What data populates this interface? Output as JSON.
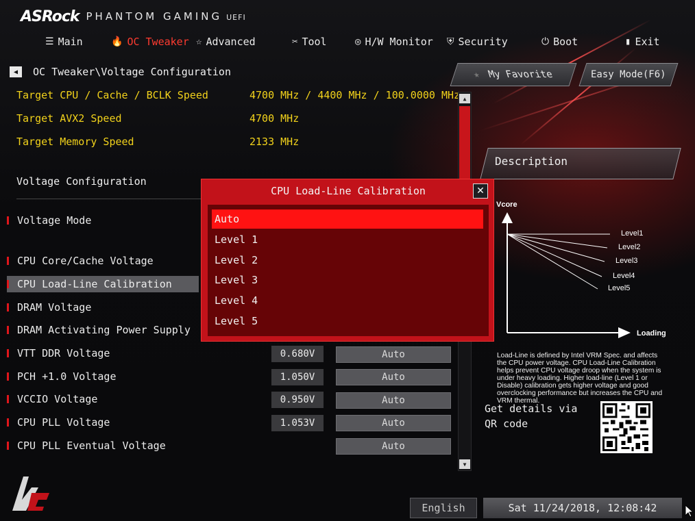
{
  "brand": {
    "name": "ASRock",
    "product": "PHANTOM GAMING",
    "uefi": "UEFI"
  },
  "nav": {
    "tabs": [
      {
        "label": "Main",
        "icon": "list-icon"
      },
      {
        "label": "OC Tweaker",
        "icon": "flame-icon",
        "active": true
      },
      {
        "label": "Advanced",
        "icon": "star-arrow-icon"
      },
      {
        "label": "Tool",
        "icon": "tools-icon"
      },
      {
        "label": "H/W Monitor",
        "icon": "monitor-icon"
      },
      {
        "label": "Security",
        "icon": "shield-icon"
      },
      {
        "label": "Boot",
        "icon": "power-icon"
      },
      {
        "label": "Exit",
        "icon": "exit-icon"
      }
    ]
  },
  "breadcrumb": "OC Tweaker\\Voltage Configuration",
  "buttons": {
    "favorite": "My Favorite",
    "easy_mode": "Easy Mode(F6)"
  },
  "info": [
    {
      "label": "Target CPU / Cache / BCLK Speed",
      "value": "4700 MHz / 4400 MHz / 100.0000 MHz"
    },
    {
      "label": "Target AVX2 Speed",
      "value": "4700 MHz"
    },
    {
      "label": "Target Memory Speed",
      "value": "2133 MHz"
    }
  ],
  "section_title": "Voltage Configuration",
  "items": [
    {
      "label": "Voltage Mode"
    },
    {
      "label": "CPU Core/Cache Voltage"
    },
    {
      "label": "CPU Load-Line Calibration",
      "highlighted": true
    },
    {
      "label": "DRAM Voltage"
    },
    {
      "label": "DRAM Activating Power Supply"
    },
    {
      "label": "VTT DDR Voltage",
      "value": "0.680V",
      "setting": "Auto"
    },
    {
      "label": "PCH +1.0 Voltage",
      "value": "1.050V",
      "setting": "Auto"
    },
    {
      "label": "VCCIO Voltage",
      "value": "0.950V",
      "setting": "Auto"
    },
    {
      "label": "CPU PLL Voltage",
      "value": "1.053V",
      "setting": "Auto"
    },
    {
      "label": "CPU PLL Eventual Voltage",
      "setting": "Auto"
    }
  ],
  "description": {
    "title": "Description",
    "chart": {
      "y_label": "Vcore",
      "x_label": "Loading",
      "levels": [
        "Level1",
        "Level2",
        "Level3",
        "Level4",
        "Level5"
      ]
    },
    "text": "Load-Line is defined by Intel VRM Spec. and affects the CPU power voltage. CPU Load-Line Calibration helps prevent CPU voltage droop when the system is under heavy loading. Higher load-line (Level 1 or Disable) calibration gets higher voltage and good overclocking performance but increases the CPU and VRM thermal.",
    "qr_text": "Get details via QR code"
  },
  "dialog": {
    "title": "CPU Load-Line Calibration",
    "options": [
      "Auto",
      "Level 1",
      "Level 2",
      "Level 3",
      "Level 4",
      "Level 5"
    ],
    "selected_index": 0
  },
  "footer": {
    "language": "English",
    "datetime": "Sat 11/24/2018, 12:08:42"
  },
  "colors": {
    "accent": "#c2121a",
    "highlight_option": "#ff1212",
    "info_text": "#f2d21b"
  }
}
